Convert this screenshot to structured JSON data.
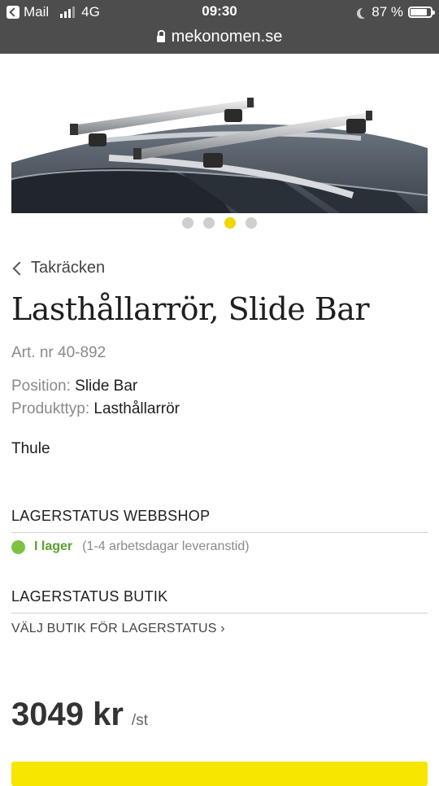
{
  "status_bar": {
    "back_app": "Mail",
    "network": "4G",
    "time": "09:30",
    "battery": "87 %",
    "battery_level": 0.87
  },
  "browser": {
    "url": "mekonomen.se"
  },
  "carousel": {
    "count": 4,
    "active_index": 2,
    "active_color": "#f0d800",
    "image_icon": "car-roof-rack-image"
  },
  "breadcrumb": {
    "label": "Takräcken"
  },
  "product": {
    "title": "Lasthållarrör, Slide Bar",
    "art_nr": "Art. nr 40-892",
    "position_label": "Position:",
    "position_value": "Slide Bar",
    "type_label": "Produkttyp:",
    "type_value": "Lasthållarrör",
    "brand": "Thule"
  },
  "stock_web": {
    "heading": "LAGERSTATUS WEBBSHOP",
    "status": "I lager",
    "note": "(1-4 arbetsdagar leveranstid)",
    "status_color": "#7ec242"
  },
  "stock_store": {
    "heading": "LAGERSTATUS BUTIK",
    "link": "VÄLJ BUTIK FÖR LAGERSTATUS ›"
  },
  "price": {
    "value": "3049 kr",
    "unit": "/st"
  },
  "colors": {
    "accent": "#f7e600",
    "header": "#4d4d4d"
  }
}
